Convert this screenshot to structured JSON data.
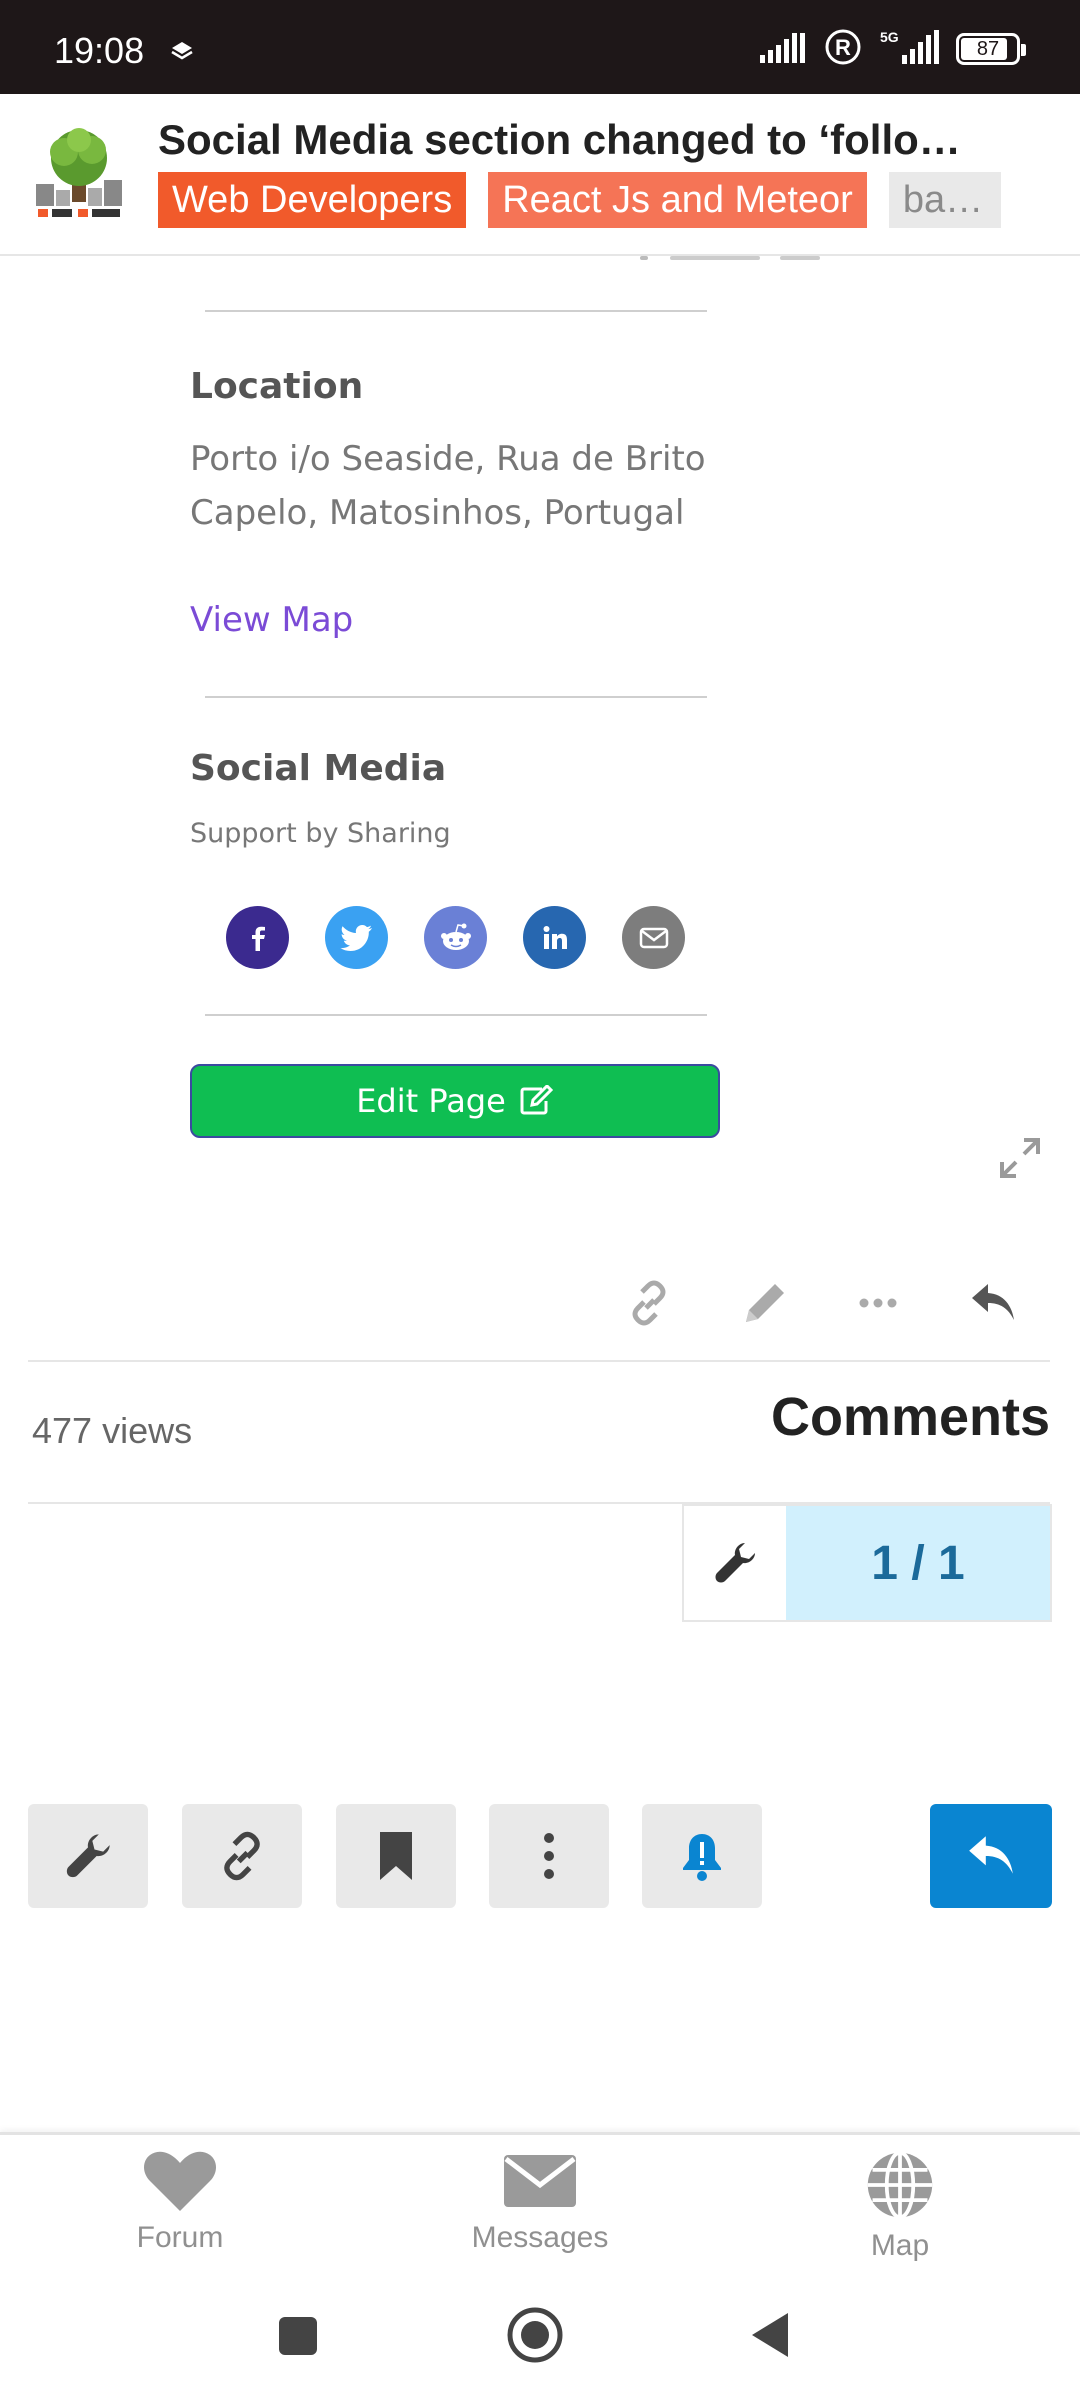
{
  "status_bar": {
    "time": "19:08",
    "battery": "87",
    "battery_fraction": 0.87,
    "network": "5G"
  },
  "header": {
    "title": "Social Media section changed to ‘follow …",
    "tags": [
      "Web Developers",
      "React Js and Meteor",
      "bac…"
    ],
    "logo_icon": "focal-local-tree-logo"
  },
  "location": {
    "heading": "Location",
    "address": "Porto i/o Seaside, Rua de Brito Capelo, Matosinhos, Portugal",
    "map_link": "View Map"
  },
  "social": {
    "heading": "Social Media",
    "subheading": "Support by Sharing",
    "buttons": [
      {
        "icon": "facebook-icon",
        "color": "#3b2a8f"
      },
      {
        "icon": "twitter-icon",
        "color": "#3aa1f2"
      },
      {
        "icon": "reddit-icon",
        "color": "#6a80d6"
      },
      {
        "icon": "linkedin-icon",
        "color": "#2767b0"
      },
      {
        "icon": "email-icon",
        "color": "#7d7d7d"
      }
    ]
  },
  "edit_button": {
    "label": "Edit Page"
  },
  "stats": {
    "views": "477 views",
    "comments_title": "Comments"
  },
  "pager": {
    "count": "1 / 1"
  },
  "bottom_nav": {
    "items": [
      {
        "label": "Forum",
        "icon": "heart-icon"
      },
      {
        "label": "Messages",
        "icon": "envelope-icon"
      },
      {
        "label": "Map",
        "icon": "globe-icon"
      }
    ]
  },
  "colors": {
    "accent_orange": "#f15a2b",
    "edit_green": "#0fbe52",
    "reply_blue": "#0a85d1",
    "pager_bg": "#d1f0fd"
  }
}
